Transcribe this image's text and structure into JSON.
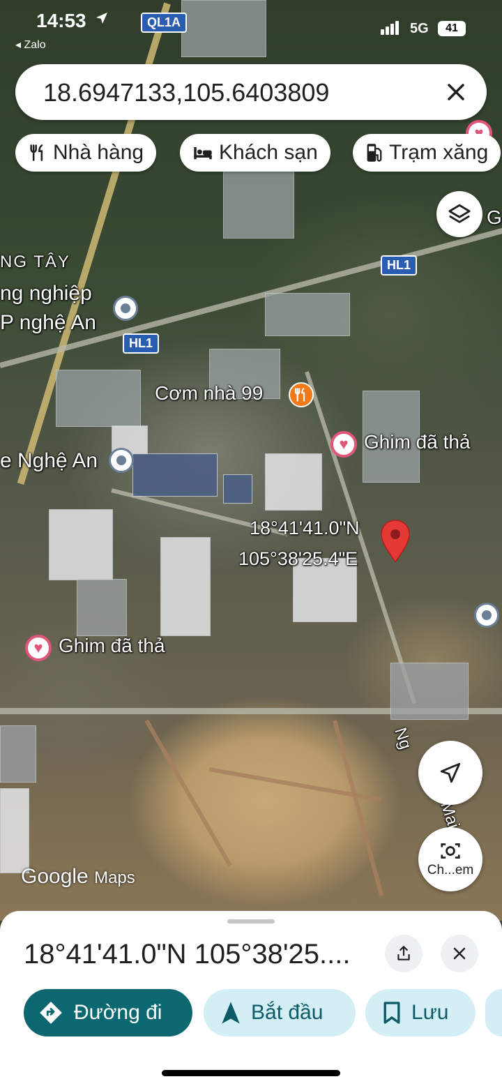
{
  "status_bar": {
    "time": "14:53",
    "back_app": "◂ Zalo",
    "network": "5G",
    "battery": "41"
  },
  "search": {
    "query": "18.6947133,105.6403809"
  },
  "chips": [
    {
      "label": "Nhà hàng",
      "icon": "restaurant-icon"
    },
    {
      "label": "Khách sạn",
      "icon": "hotel-icon"
    },
    {
      "label": "Trạm xăng",
      "icon": "gas-station-icon"
    }
  ],
  "map": {
    "road_shields": [
      "QL1A",
      "HL1",
      "HL1"
    ],
    "labels": {
      "district": "NG TÂY",
      "industrial_1": "ng nghiệp",
      "industrial_2": "P nghệ An",
      "restaurant": "Cơm nhà 99",
      "pin_saved_1": "Ghim đã thả",
      "pin_saved_2": "Ghim đã thả",
      "nghe_an": "e Nghệ An",
      "coord_lat": "18°41'41.0\"N",
      "coord_lng": "105°38'25.4\"E",
      "street_1": "Ng",
      "street_2": "Mai",
      "edge_g": "G"
    },
    "watermark_google": "Google",
    "watermark_maps": "Maps",
    "camera_label": "Ch...em"
  },
  "sheet": {
    "title": "18°41'41.0\"N 105°38'25....",
    "buttons": {
      "directions": "Đường đi",
      "start": "Bắt đầu",
      "save": "Lưu"
    }
  },
  "colors": {
    "primary": "#0b6770",
    "secondary_bg": "#d4eef6",
    "pin_red": "#e53935",
    "heart_pink": "#e0567a",
    "shield_blue": "#2a5db0"
  }
}
